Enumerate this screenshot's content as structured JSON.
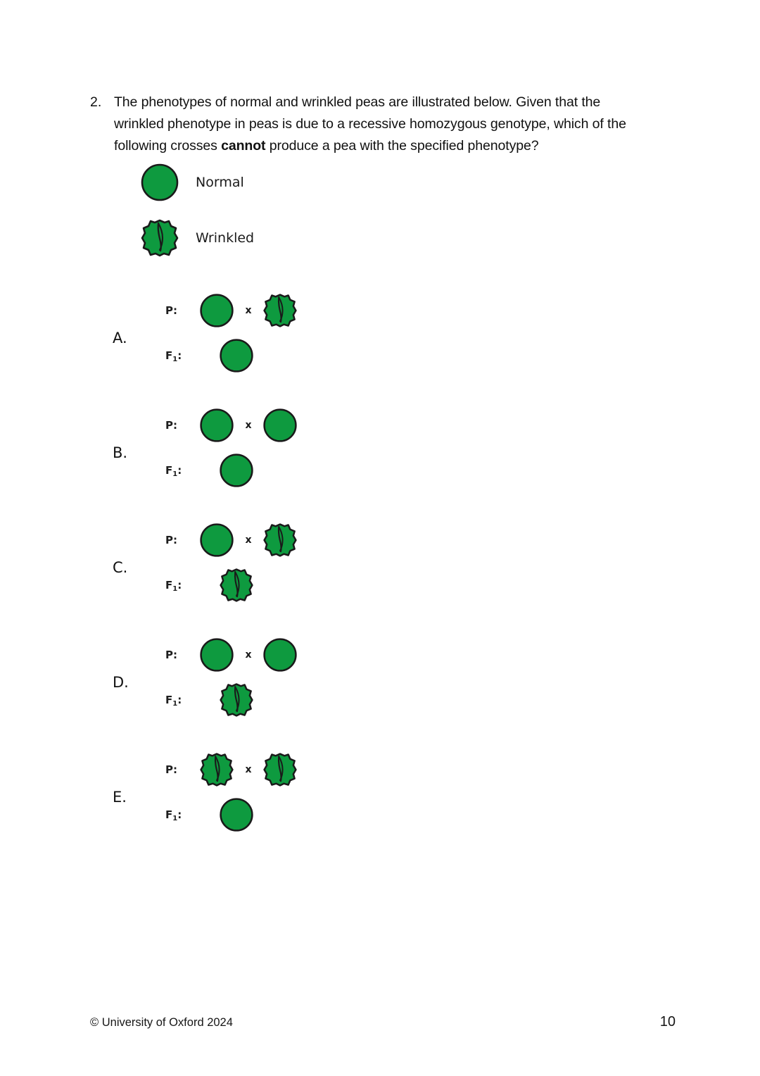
{
  "question": {
    "number": "2.",
    "text_before_bold": "The phenotypes of normal and wrinkled peas are illustrated below. Given that the wrinkled phenotype in peas is due to a recessive homozygous genotype, which of the following crosses ",
    "bold_word": "cannot",
    "text_after_bold": " produce a pea with the specified phenotype?"
  },
  "legend": {
    "items": [
      {
        "shape": "normal-pea-icon",
        "label": "Normal"
      },
      {
        "shape": "wrinkled-pea-icon",
        "label": "Wrinkled"
      }
    ]
  },
  "labels": {
    "parent": "P:",
    "f1_prefix": "F",
    "f1_subscript": "1",
    "f1_suffix": ":",
    "cross_symbol": "x"
  },
  "options": [
    {
      "letter": "A.",
      "parents": [
        "normal",
        "wrinkled"
      ],
      "offspring": "normal"
    },
    {
      "letter": "B.",
      "parents": [
        "normal",
        "normal"
      ],
      "offspring": "normal"
    },
    {
      "letter": "C.",
      "parents": [
        "normal",
        "wrinkled"
      ],
      "offspring": "wrinkled"
    },
    {
      "letter": "D.",
      "parents": [
        "normal",
        "normal"
      ],
      "offspring": "wrinkled"
    },
    {
      "letter": "E.",
      "parents": [
        "wrinkled",
        "wrinkled"
      ],
      "offspring": "normal"
    }
  ],
  "footer": {
    "copyright": "© University of Oxford 2024",
    "page_number": "10"
  },
  "colors": {
    "pea_green": "#0e9a3f",
    "pea_green_shade": "#13a846",
    "pea_outline": "#1a1a1a",
    "text": "#111111"
  }
}
